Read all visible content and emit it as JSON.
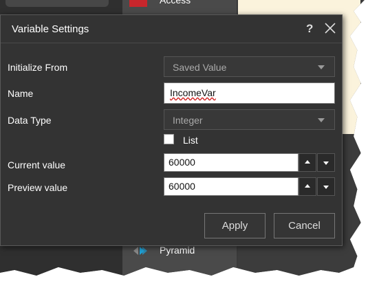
{
  "background": {
    "top_menu_item": "Access",
    "bottom_menu_item": "Pyramid"
  },
  "dialog": {
    "title": "Variable Settings",
    "help_label": "?",
    "fields": {
      "initialize_from": {
        "label": "Initialize From",
        "value": "Saved Value"
      },
      "name": {
        "label": "Name",
        "value": "IncomeVar"
      },
      "data_type": {
        "label": "Data Type",
        "value": "Integer"
      },
      "list": {
        "label": "List",
        "checked": false
      },
      "current_value": {
        "label": "Current value",
        "value": "60000"
      },
      "preview_value": {
        "label": "Preview value",
        "value": "60000"
      }
    },
    "buttons": {
      "apply": "Apply",
      "cancel": "Cancel"
    }
  },
  "colors": {
    "dialog_bg": "#333333",
    "note_bg": "#fbf3dc",
    "access_icon": "#c8262c"
  }
}
